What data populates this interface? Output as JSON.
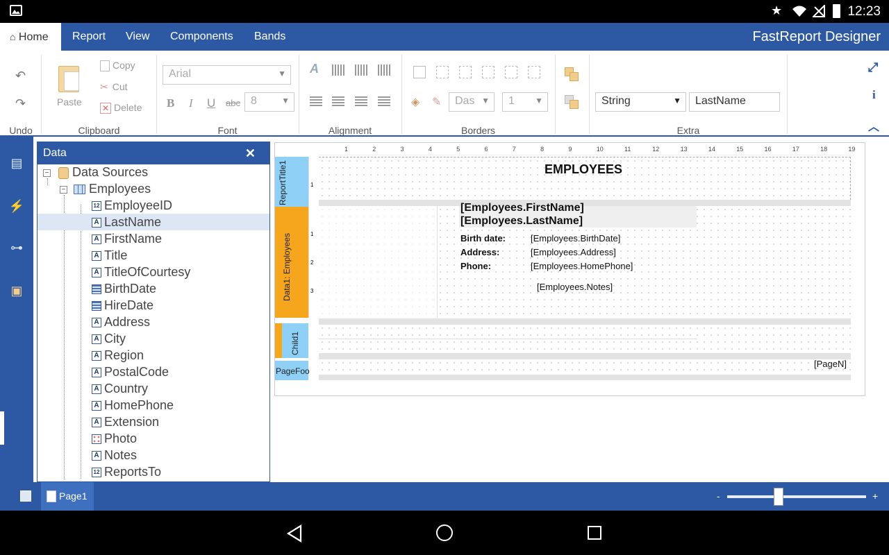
{
  "status": {
    "time": "12:23"
  },
  "menu": {
    "tabs": [
      {
        "label": "Home"
      },
      {
        "label": "Report"
      },
      {
        "label": "View"
      },
      {
        "label": "Components"
      },
      {
        "label": "Bands"
      }
    ],
    "app_title": "FastReport Designer"
  },
  "ribbon": {
    "undo_group": "Undo",
    "clipboard": {
      "paste": "Paste",
      "copy": "Copy",
      "cut": "Cut",
      "delete": "Delete",
      "label": "Clipboard"
    },
    "font": {
      "family": "Arial",
      "size": "8",
      "label": "Font"
    },
    "alignment": {
      "label": "Alignment"
    },
    "borders": {
      "line_style": "Das",
      "line_width": "1",
      "label": "Borders"
    },
    "extra": {
      "type": "String",
      "value": "LastName",
      "label": "Extra"
    }
  },
  "data_panel": {
    "title": "Data",
    "root": "Data Sources",
    "table": "Employees",
    "fields": [
      {
        "name": "EmployeeID",
        "type": "12"
      },
      {
        "name": "LastName",
        "type": "A"
      },
      {
        "name": "FirstName",
        "type": "A"
      },
      {
        "name": "Title",
        "type": "A"
      },
      {
        "name": "TitleOfCourtesy",
        "type": "A"
      },
      {
        "name": "BirthDate",
        "type": "date"
      },
      {
        "name": "HireDate",
        "type": "date"
      },
      {
        "name": "Address",
        "type": "A"
      },
      {
        "name": "City",
        "type": "A"
      },
      {
        "name": "Region",
        "type": "A"
      },
      {
        "name": "PostalCode",
        "type": "A"
      },
      {
        "name": "Country",
        "type": "A"
      },
      {
        "name": "HomePhone",
        "type": "A"
      },
      {
        "name": "Extension",
        "type": "A"
      },
      {
        "name": "Photo",
        "type": "img"
      },
      {
        "name": "Notes",
        "type": "A"
      },
      {
        "name": "ReportsTo",
        "type": "12"
      }
    ],
    "selected": "LastName"
  },
  "report": {
    "ruler": [
      "1",
      "2",
      "3",
      "4",
      "5",
      "6",
      "7",
      "8",
      "9",
      "10",
      "11",
      "12",
      "13",
      "14",
      "15",
      "16",
      "17",
      "18",
      "19"
    ],
    "bands": {
      "title_band": "ReportTitle1",
      "data_band": "Data1: Employees",
      "child_band": "Child1",
      "footer_band": "PageFoo"
    },
    "title_text": "EMPLOYEES",
    "first_name": "[Employees.FirstName]",
    "last_name": "[Employees.LastName]",
    "birth_label": "Birth date:",
    "address_label": "Address:",
    "phone_label": "Phone:",
    "birth_value": "[Employees.BirthDate]",
    "address_value": "[Employees.Address]",
    "phone_value": "[Employees.HomePhone]",
    "notes_value": "[Employees.Notes]",
    "page_number": "[PageN]"
  },
  "bottom": {
    "page_tab": "Page1",
    "zoom_minus": "-",
    "zoom_plus": "+",
    "zoom_level": 0.37
  }
}
